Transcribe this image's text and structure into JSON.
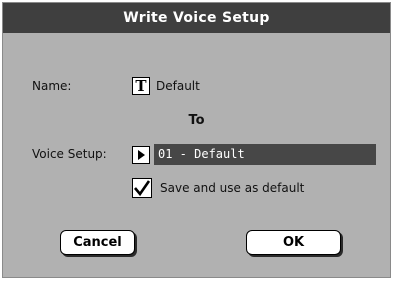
{
  "dialog": {
    "title": "Write Voice Setup",
    "name_label": "Name:",
    "name_value": "Default",
    "name_icon": "text-edit-icon",
    "to_label": "To",
    "voice_setup_label": "Voice Setup:",
    "voice_setup_value": "01 - Default",
    "checkbox_label": "Save and use as default",
    "checkbox_checked": true,
    "cancel_label": "Cancel",
    "ok_label": "OK"
  },
  "colors": {
    "dialog_bg": "#b1b1b1",
    "titlebar_bg": "#3f3f3f",
    "field_bg": "#474747"
  }
}
